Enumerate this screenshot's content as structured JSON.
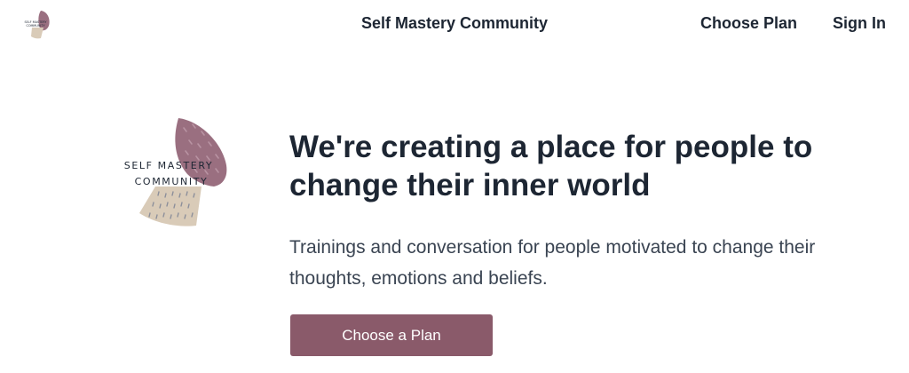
{
  "header": {
    "site_title": "Self Mastery Community",
    "nav": {
      "choose_plan": "Choose Plan",
      "sign_in": "Sign In"
    },
    "logo_text": {
      "line1": "SELF MASTERY",
      "line2": "COMMUNITY"
    }
  },
  "hero": {
    "logo_text": {
      "line1": "SELF MASTERY",
      "line2": "COMMUNITY"
    },
    "title": "We're creating a place for people to change their inner world",
    "subtitle": "Trainings and conversation for people motivated to change their thoughts, emotions and beliefs.",
    "cta_label": "Choose a Plan"
  },
  "colors": {
    "text": "#1d2633",
    "subtext": "#3a4452",
    "accent": "#8a5a6a",
    "logo_mauve": "#9a6f80",
    "logo_sand": "#d9cbb8"
  },
  "icons": {
    "logo": "self-mastery-logo-icon"
  }
}
